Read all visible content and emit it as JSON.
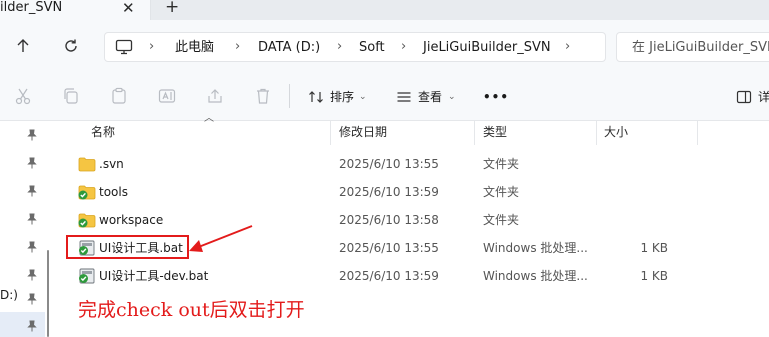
{
  "tab": {
    "title": "ilder_SVN"
  },
  "breadcrumb": [
    "此电脑",
    "DATA (D:)",
    "Soft",
    "JieLiGuiBuilder_SVN"
  ],
  "search": {
    "placeholder": "在 JieLiGuiBuilder_SVN"
  },
  "toolbar": {
    "sort_label": "排序",
    "view_label": "查看",
    "more_label": "•••",
    "details_label": "详"
  },
  "nav": {
    "drive_label": "D:)"
  },
  "columns": {
    "name": "名称",
    "date": "修改日期",
    "type": "类型",
    "size": "大小"
  },
  "files": [
    {
      "name": ".svn",
      "date": "2025/6/10 13:55",
      "type": "文件夹",
      "size": "",
      "icon": "folder-icon"
    },
    {
      "name": "tools",
      "date": "2025/6/10 13:59",
      "type": "文件夹",
      "size": "",
      "icon": "svn-folder-icon"
    },
    {
      "name": "workspace",
      "date": "2025/6/10 13:58",
      "type": "文件夹",
      "size": "",
      "icon": "svn-folder-icon"
    },
    {
      "name": "UI设计工具.bat",
      "date": "2025/6/10 13:55",
      "type": "Windows 批处理...",
      "size": "1 KB",
      "icon": "svn-bat-icon"
    },
    {
      "name": "UI设计工具-dev.bat",
      "date": "2025/6/10 13:59",
      "type": "Windows 批处理...",
      "size": "1 KB",
      "icon": "svn-bat-icon"
    }
  ],
  "annotation": {
    "text": "完成check out后双击打开",
    "color": "#e31b1b"
  },
  "colors": {
    "accent": "#e31b1b",
    "folder": "#f5c542",
    "svn_check": "#2e9a3c"
  }
}
